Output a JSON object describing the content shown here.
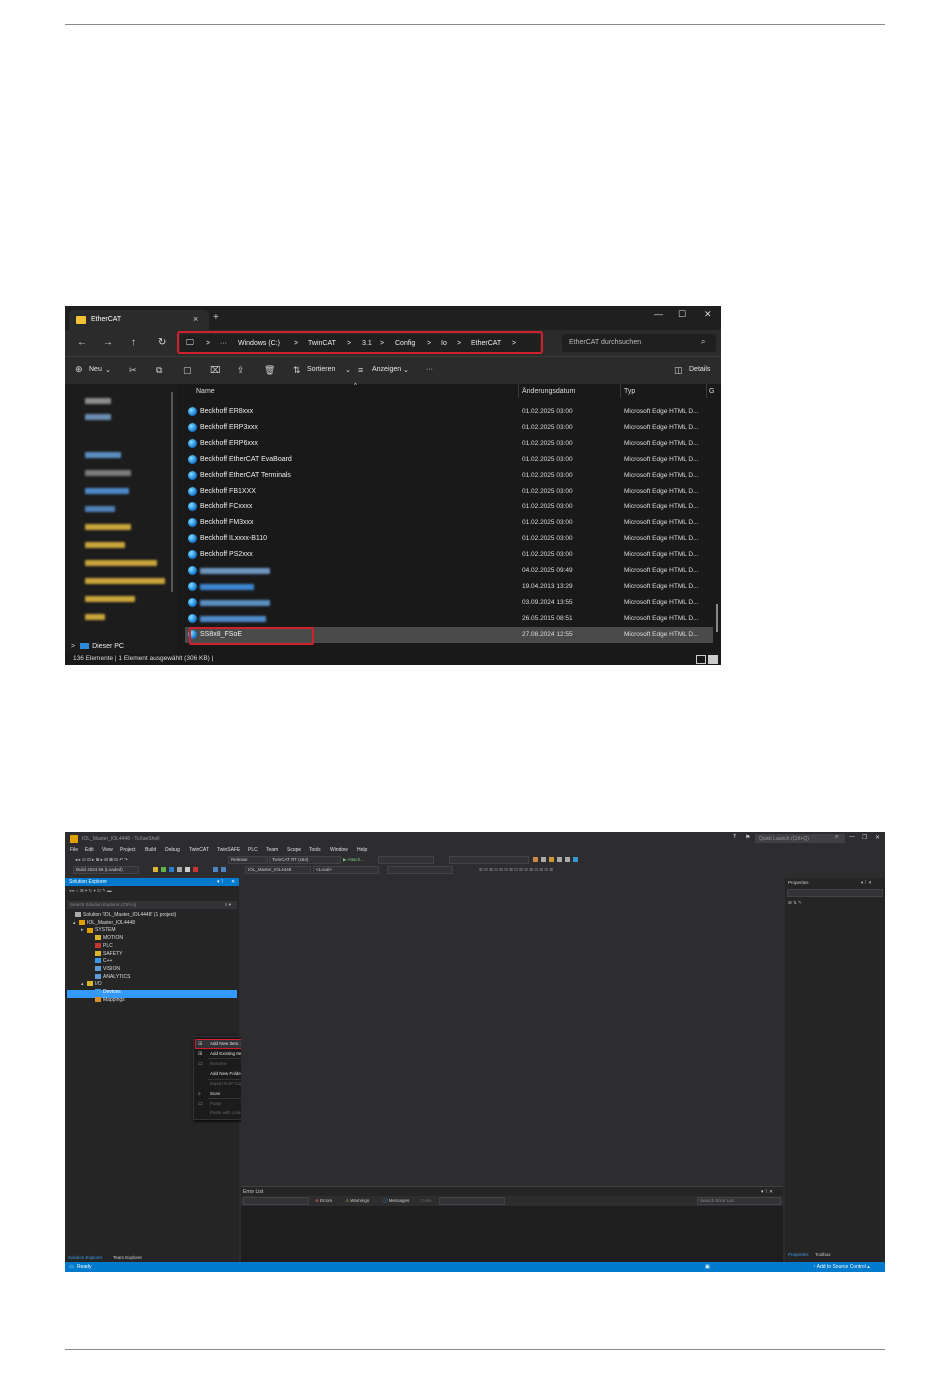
{
  "explorer": {
    "tab_title": "EtherCAT",
    "tab_close": "×",
    "new_tab": "+",
    "window_controls": [
      "—",
      "☐",
      "✕"
    ],
    "nav": [
      "←",
      "→",
      "↑",
      "↻"
    ],
    "breadcrumb": [
      "Windows (C:)",
      "TwinCAT",
      "3.1",
      "Config",
      "Io",
      "EtherCAT"
    ],
    "breadcrumb_sep": ">",
    "breadcrumb_more": "···",
    "search_placeholder": "EtherCAT durchsuchen",
    "toolbar": {
      "new": "Neu",
      "sort": "Sortieren",
      "view": "Anzeigen",
      "more": "···",
      "details": "Details"
    },
    "columns": {
      "name": "Name",
      "date": "Änderungsdatum",
      "type": "Typ",
      "size": "G"
    },
    "files": [
      {
        "name": "Beckhoff ER8xxx",
        "date": "01.02.2025 03:00",
        "type": "Microsoft Edge HTML D..."
      },
      {
        "name": "Beckhoff ERP3xxx",
        "date": "01.02.2025 03:00",
        "type": "Microsoft Edge HTML D..."
      },
      {
        "name": "Beckhoff ERP6xxx",
        "date": "01.02.2025 03:00",
        "type": "Microsoft Edge HTML D..."
      },
      {
        "name": "Beckhoff EtherCAT EvaBoard",
        "date": "01.02.2025 03:00",
        "type": "Microsoft Edge HTML D..."
      },
      {
        "name": "Beckhoff EtherCAT Terminals",
        "date": "01.02.2025 03:00",
        "type": "Microsoft Edge HTML D..."
      },
      {
        "name": "Beckhoff FB1XXX",
        "date": "01.02.2025 03:00",
        "type": "Microsoft Edge HTML D..."
      },
      {
        "name": "Beckhoff FCxxxx",
        "date": "01.02.2025 03:00",
        "type": "Microsoft Edge HTML D..."
      },
      {
        "name": "Beckhoff FM3xxx",
        "date": "01.02.2025 03:00",
        "type": "Microsoft Edge HTML D..."
      },
      {
        "name": "Beckhoff ILxxxx-B110",
        "date": "01.02.2025 03:00",
        "type": "Microsoft Edge HTML D..."
      },
      {
        "name": "Beckhoff PS2xxx",
        "date": "01.02.2025 03:00",
        "type": "Microsoft Edge HTML D..."
      },
      {
        "name": "",
        "date": "04.02.2025 09:49",
        "type": "Microsoft Edge HTML D..."
      },
      {
        "name": "",
        "date": "19.04.2013 13:29",
        "type": "Microsoft Edge HTML D..."
      },
      {
        "name": "",
        "date": "03.09.2024 13:55",
        "type": "Microsoft Edge HTML D..."
      },
      {
        "name": "",
        "date": "26.05.2015 08:51",
        "type": "Microsoft Edge HTML D..."
      },
      {
        "name": "SS8x8_FSoE",
        "date": "27.08.2024 12:55",
        "type": "Microsoft Edge HTML D..."
      }
    ],
    "this_pc": "Dieser PC",
    "status": "136 Elemente  |  1 Element ausgewählt (306 KB)  |"
  },
  "ide": {
    "title": "IOL_Master_IOL4448 - TcXaeShell",
    "quick_launch": "Quick Launch (Ctrl+Q)",
    "window_controls": [
      "—",
      "❐",
      "✕"
    ],
    "menu": [
      "File",
      "Edit",
      "View",
      "Project",
      "Build",
      "Debug",
      "TwinCAT",
      "TwinSAFE",
      "PLC",
      "Team",
      "Scope",
      "Tools",
      "Window",
      "Help"
    ],
    "toolbar1": {
      "config": "Release",
      "platform": "TwinCAT RT (x64)",
      "attach": "▶ Attach..."
    },
    "toolbar2": {
      "build": "Build 4024.56 (Loaded)",
      "project": "IOL_Master_IOL4448",
      "target": "<Local>"
    },
    "solution_explorer": {
      "title": "Solution Explorer",
      "search": "Search Solution Explorer (Ctrl+ü)",
      "tree": [
        "Solution 'IOL_Master_IOL4448' (1 project)",
        "IOL_Master_IOL4448",
        "SYSTEM",
        "MOTION",
        "PLC",
        "SAFETY",
        "C++",
        "VISION",
        "ANALYTICS",
        "I/O",
        "Devices",
        "Mappings"
      ],
      "tabs": [
        "Solution Explorer",
        "Team Explorer"
      ]
    },
    "context_menu": [
      {
        "label": "Add New Item...",
        "shortcut": "Ins",
        "enabled": true
      },
      {
        "label": "Add Existing Item...",
        "shortcut": "Shift+Alt+A",
        "enabled": true
      },
      {
        "label": "Rename",
        "shortcut": "",
        "enabled": false
      },
      {
        "label": "Add New Folder...",
        "shortcut": "",
        "enabled": true
      },
      {
        "label": "Export EAP Config File",
        "shortcut": "",
        "enabled": false
      },
      {
        "label": "Scan",
        "shortcut": "",
        "enabled": true
      },
      {
        "label": "Paste",
        "shortcut": "Ctrl+V",
        "enabled": false
      },
      {
        "label": "Paste with Links",
        "shortcut": "",
        "enabled": false
      }
    ],
    "error_list": {
      "title": "Error List",
      "errors": "Errors",
      "warnings": "Warnings",
      "messages": "Messages",
      "code": "Code",
      "search": "Search Error List"
    },
    "properties": {
      "title": "Properties",
      "tabs": [
        "Properties",
        "Toolbox"
      ]
    },
    "status": {
      "ready": "Ready",
      "source_control": "↑  Add to Source Control ▴"
    }
  },
  "colors": {
    "accent": "#007acc",
    "highlight": "#d0202e",
    "folder": "#f2c232"
  }
}
